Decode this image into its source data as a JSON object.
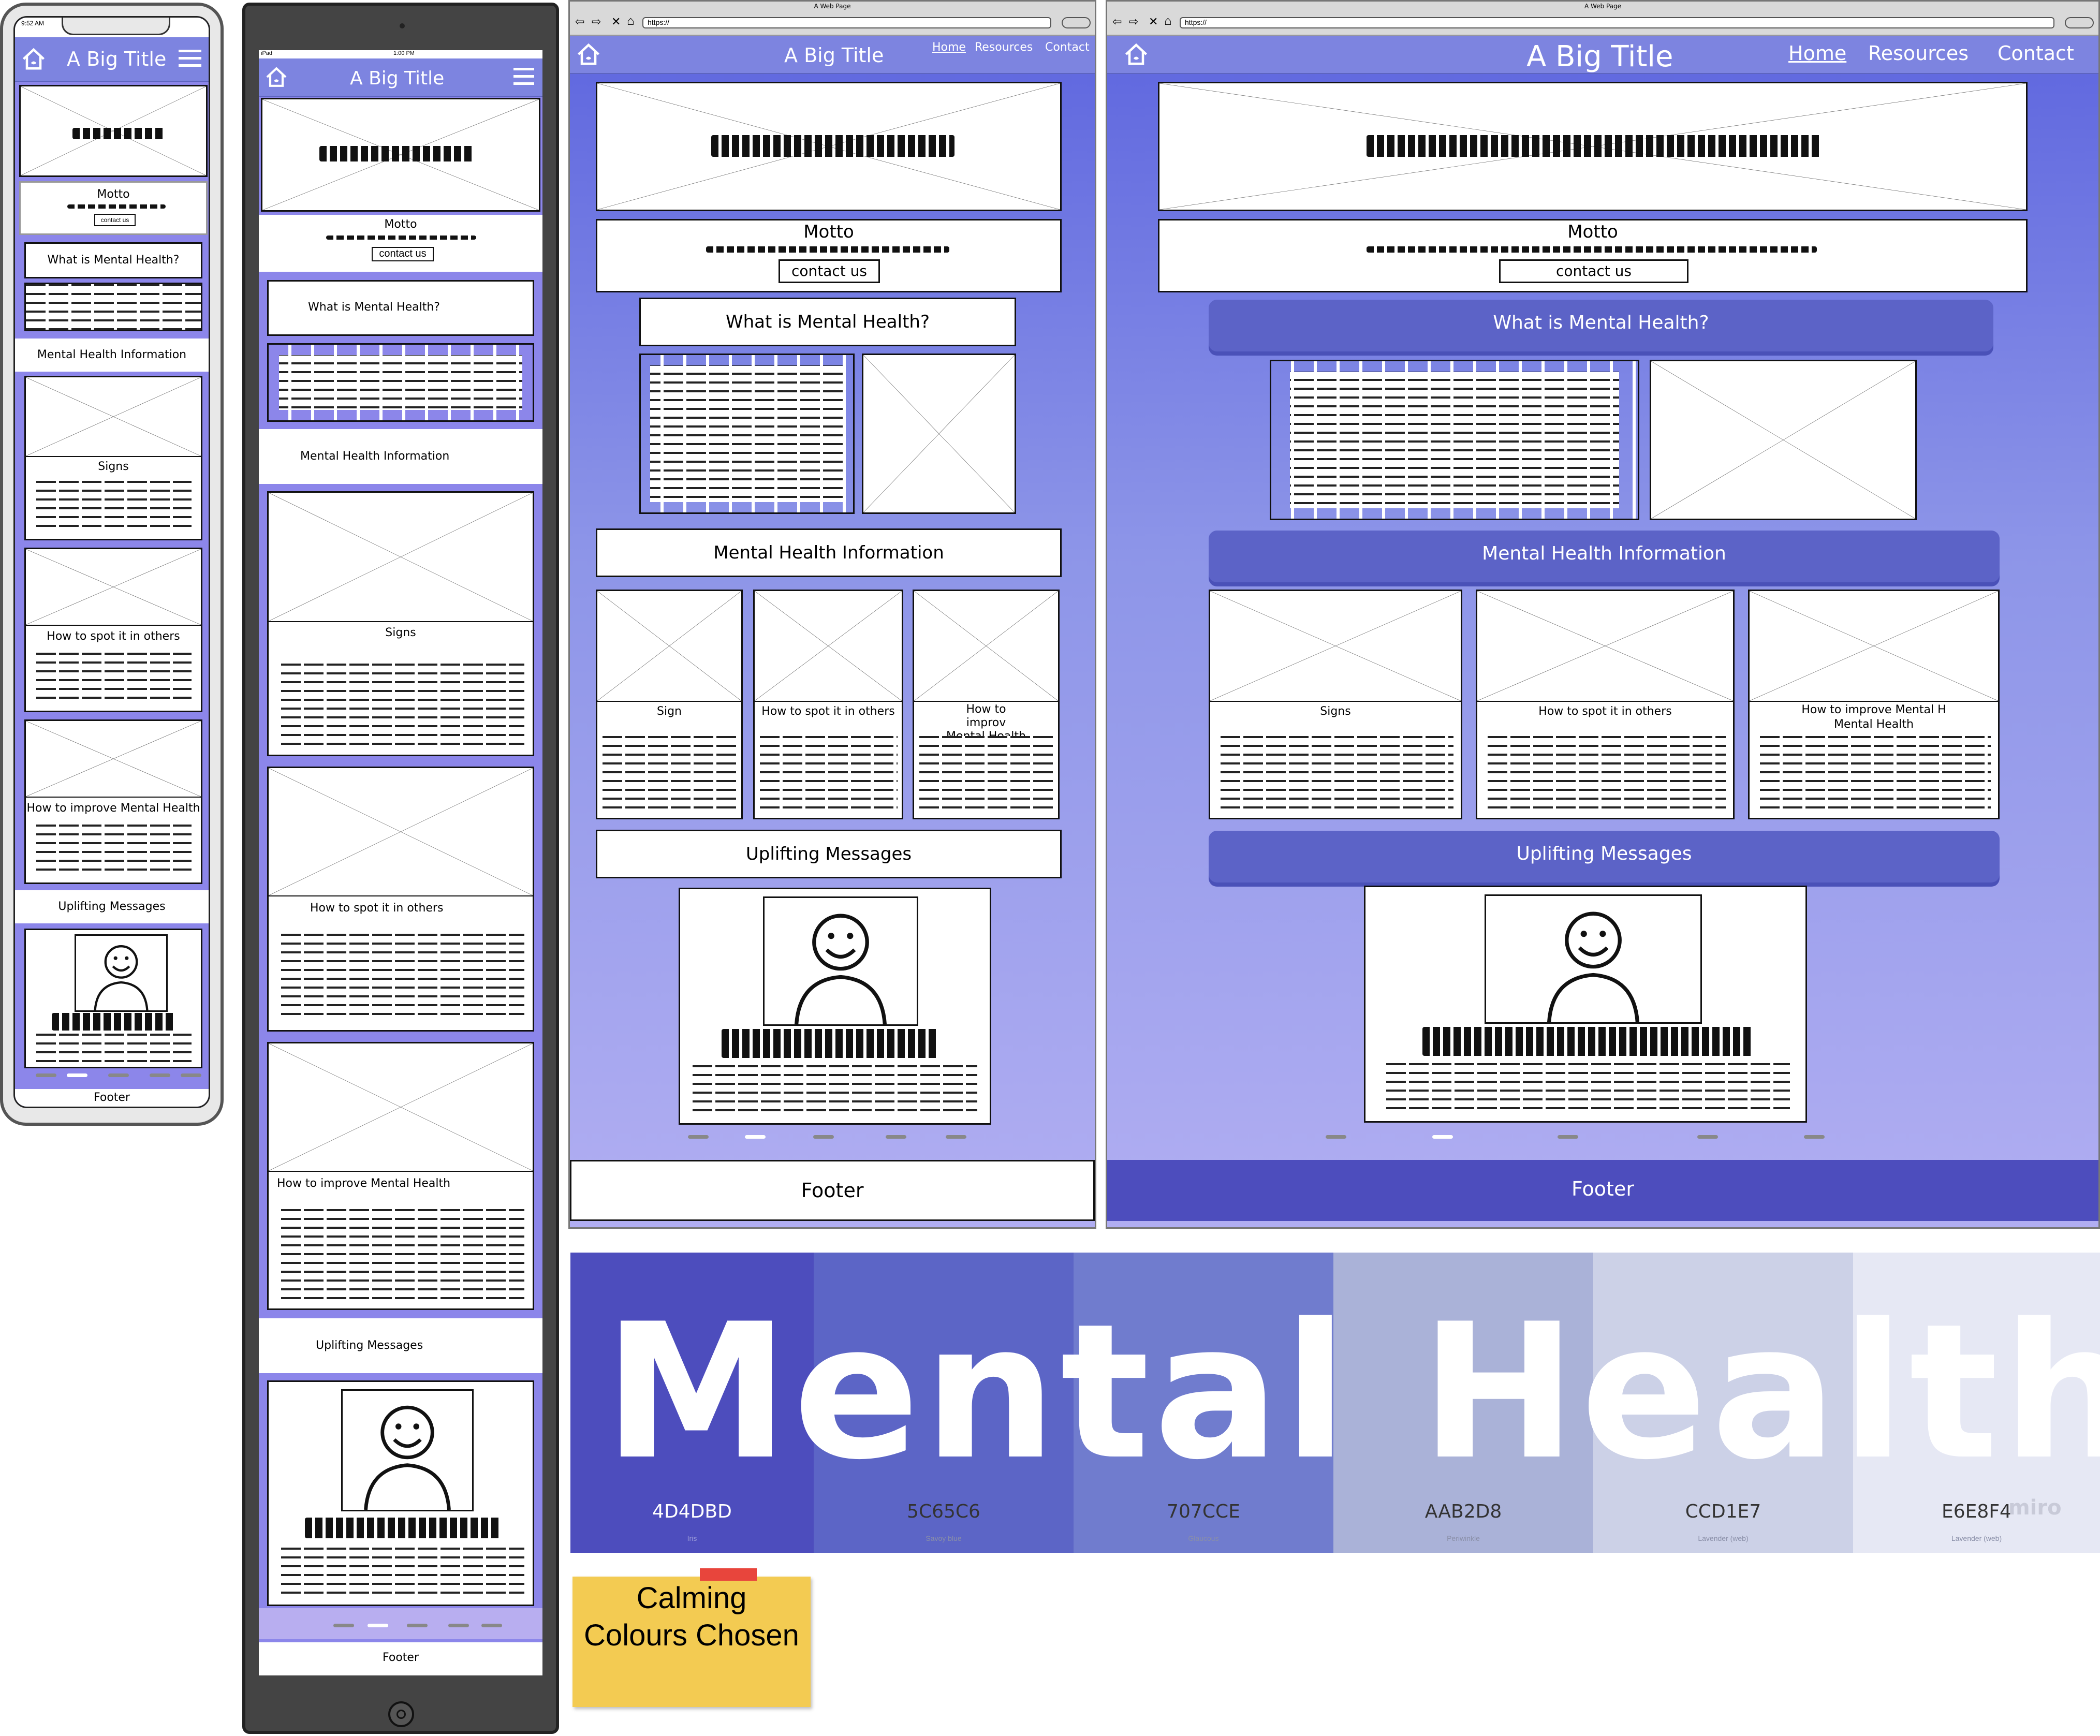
{
  "site": {
    "title": "A Big Title",
    "motto": "Motto",
    "contact_btn": "contact us",
    "what_is": "What is Mental Health?",
    "info_heading": "Mental Health Information",
    "cards": [
      "Signs",
      "How to spot it in others",
      "How to improve Mental Health"
    ],
    "tablet_info_heading": "Mental Health Information",
    "uplifting": "Uplifting Messages",
    "footer": "Footer"
  },
  "phone": {
    "time": "9:52 AM"
  },
  "tablet": {
    "status_left": "iPad",
    "status_time": "1:00 PM"
  },
  "laptop": {
    "window_title": "A Web Page",
    "url": "https://",
    "nav": [
      "Home",
      "Resources",
      "Contact"
    ],
    "cards": [
      "Sign",
      "How to spot it in others",
      "How to improv Mental Health"
    ]
  },
  "desktop": {
    "window_title": "A Web Page",
    "url": "https://",
    "nav": [
      "Home",
      "Resources",
      "Contact"
    ],
    "cards": [
      "Signs",
      "How to spot it in others",
      "How to improve Mental H Mental Health"
    ]
  },
  "palette": {
    "heading": "Mental Health",
    "brand_mark": "miro",
    "colors": [
      {
        "hex": "4D4DBD",
        "name": "Iris",
        "value": "#4D4DBD"
      },
      {
        "hex": "5C65C6",
        "name": "Savoy blue",
        "value": "#5C65C6"
      },
      {
        "hex": "707CCE",
        "name": "Glaucous",
        "value": "#707CCE"
      },
      {
        "hex": "AAB2D8",
        "name": "Periwinkle",
        "value": "#AAB2D8"
      },
      {
        "hex": "CCD1E7",
        "name": "Lavender (web)",
        "value": "#CCD1E7"
      },
      {
        "hex": "E6E8F4",
        "name": "Lavender (web)",
        "value": "#E6E8F4"
      }
    ]
  },
  "sticky_note": {
    "line1": "Calming",
    "line2": "Colours Chosen"
  }
}
